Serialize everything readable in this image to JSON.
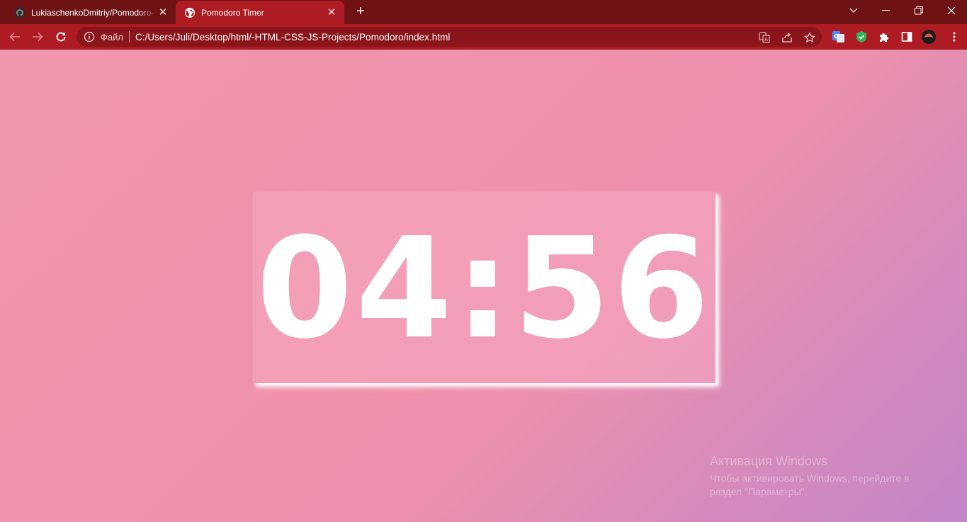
{
  "browser": {
    "tabs": [
      {
        "title": "LukiaschenkoDmitriy/Pomodoro-",
        "favicon": "github-icon",
        "active": false
      },
      {
        "title": "Pomodoro Timer",
        "favicon": "globe-icon",
        "active": true
      }
    ],
    "new_tab_icon": "plus-icon",
    "window_controls": [
      "chevron-down-icon",
      "minimize-icon",
      "restore-icon",
      "close-icon"
    ],
    "address_bar": {
      "security_label": "Файл",
      "url": "C:/Users/Juli/Desktop/html/-HTML-CSS-JS-Projects/Pomodoro/index.html"
    },
    "theme_colors": {
      "tabstrip": "#6e1214",
      "toolbar": "#ae1b22"
    }
  },
  "page": {
    "timer": "04:56",
    "background_gradient": [
      "#f097ad",
      "#c285c8"
    ],
    "timer_color": "#ffffff"
  },
  "os_watermark": {
    "line1": "Активация Windows",
    "line2": "Чтобы активировать Windows, перейдите в раздел \"Параметры\"."
  }
}
